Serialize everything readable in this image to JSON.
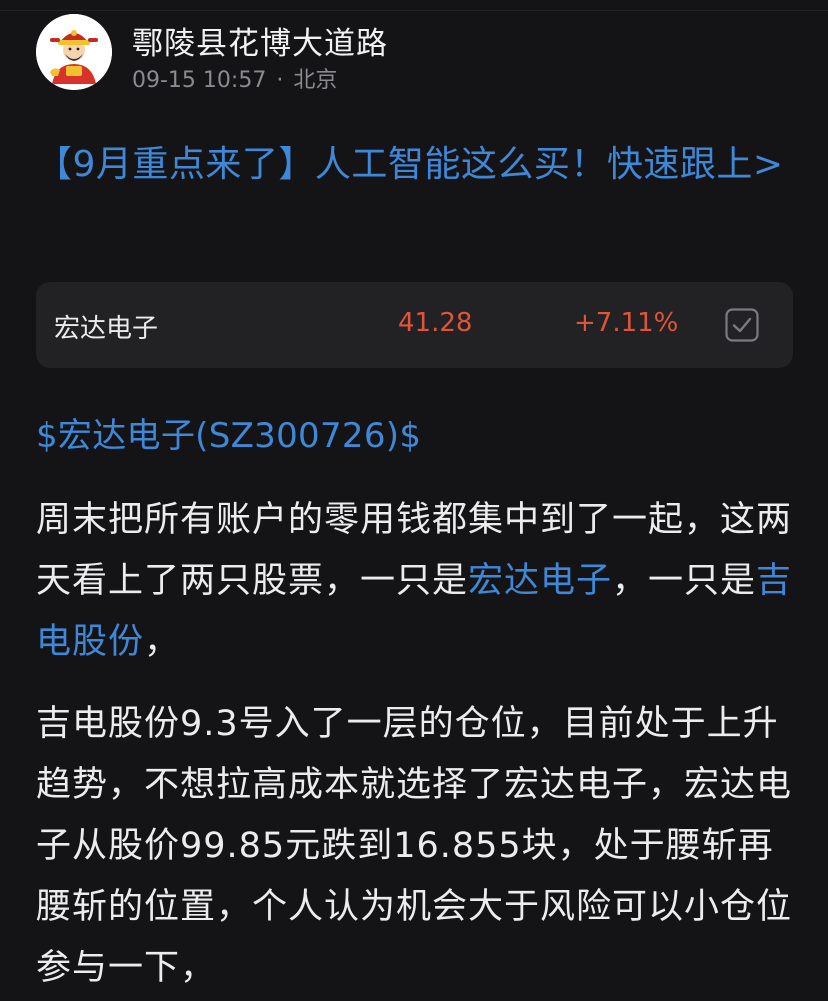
{
  "post": {
    "author": "鄠陵县花博大道路",
    "time": "09-15 10:57",
    "separator": "·",
    "location": "北京",
    "headline": "【9月重点来了】人工智能这么买！快速跟上>"
  },
  "stock_card": {
    "name": "宏达电子",
    "price": "41.28",
    "change": "+7.11%",
    "price_color": "#e1543a",
    "checkbox_icon": "checkbox-icon"
  },
  "ticker_tag": "$宏达电子(SZ300726)$",
  "paragraph1": {
    "part1": "周末把所有账户的零用钱都集中到了一起，这两天看上了两只股票，一只是",
    "link1": "宏达电子",
    "part2": "，一只是",
    "link2": "吉电股份",
    "part3": "，"
  },
  "paragraph2": "吉电股份9.3号入了一层的仓位，目前处于上升趋势，不想拉高成本就选择了宏达电子，宏达电子从股价99.85元跌到16.855块，处于腰斩再腰斩的位置，个人认为机会大于风险可以小仓位参与一下，",
  "colors": {
    "link": "#3f88d8",
    "background": "#141416",
    "card": "#222225"
  },
  "icons": {
    "avatar": "cartoon-god-of-wealth-avatar"
  }
}
